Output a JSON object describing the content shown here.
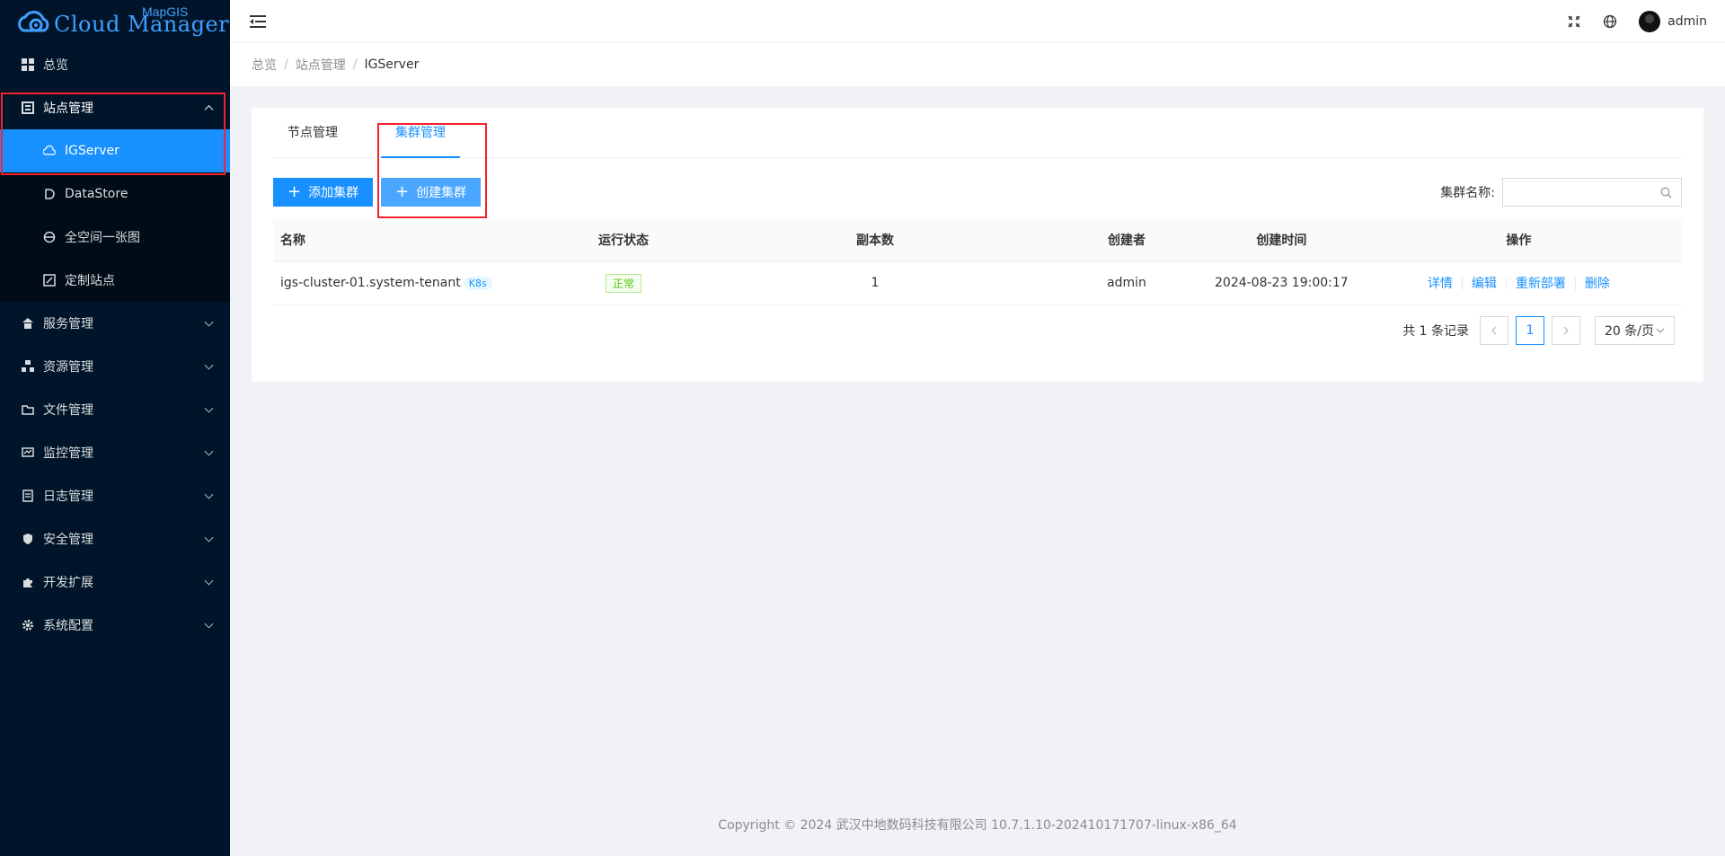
{
  "app": {
    "logo_main": "Cloud Manager",
    "logo_small": "MapGIS"
  },
  "sidebar": {
    "items": [
      {
        "label": "总览",
        "icon": "dashboard-icon"
      },
      {
        "label": "站点管理",
        "icon": "site-icon",
        "expanded": true,
        "children": [
          {
            "label": "IGServer",
            "icon": "cloud-icon",
            "active": true
          },
          {
            "label": "DataStore",
            "icon": "datastore-icon"
          },
          {
            "label": "全空间一张图",
            "icon": "globe-icon"
          },
          {
            "label": "定制站点",
            "icon": "custom-site-icon"
          }
        ]
      },
      {
        "label": "服务管理",
        "icon": "service-icon"
      },
      {
        "label": "资源管理",
        "icon": "resource-icon"
      },
      {
        "label": "文件管理",
        "icon": "folder-icon"
      },
      {
        "label": "监控管理",
        "icon": "monitor-icon"
      },
      {
        "label": "日志管理",
        "icon": "log-icon"
      },
      {
        "label": "安全管理",
        "icon": "shield-icon"
      },
      {
        "label": "开发扩展",
        "icon": "plugin-icon"
      },
      {
        "label": "系统配置",
        "icon": "gear-icon"
      }
    ]
  },
  "header": {
    "user": "admin"
  },
  "breadcrumb": [
    "总览",
    "站点管理",
    "IGServer"
  ],
  "tabs": [
    "节点管理",
    "集群管理"
  ],
  "toolbar": {
    "add_label": "添加集群",
    "create_label": "创建集群",
    "search_label": "集群名称:",
    "search_value": ""
  },
  "table": {
    "columns": [
      "名称",
      "运行状态",
      "副本数",
      "创建者",
      "创建时间",
      "操作"
    ],
    "rows": [
      {
        "name": "igs-cluster-01.system-tenant",
        "tag": "K8s",
        "status": "正常",
        "replicas": "1",
        "creator": "admin",
        "created": "2024-08-23 19:00:17",
        "actions": [
          "详情",
          "编辑",
          "重新部署",
          "删除"
        ]
      }
    ]
  },
  "pagination": {
    "total_text": "共 1 条记录",
    "current": "1",
    "page_size": "20 条/页"
  },
  "footer": "Copyright © 2024 武汉中地数码科技有限公司 10.7.1.10-202410171707-linux-x86_64",
  "colors": {
    "primary": "#1890ff",
    "sidebar_bg": "#001529",
    "success": "#52c41a",
    "highlight": "#f5222d"
  }
}
